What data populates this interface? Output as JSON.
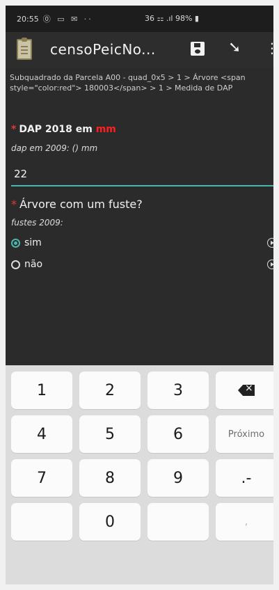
{
  "status_bar": {
    "time": "20:55",
    "left_icons": "⓪ ▭ ✉ ··",
    "system": "36 ⚏ .ıl 98% ▮"
  },
  "toolbar": {
    "title": "censoPeicNo...",
    "save_icon": "save-icon",
    "arrow_icon": "jump-arrow-icon",
    "more_icon": "more-vert-icon"
  },
  "breadcrumb": "Subquadrado da Parcela A00 - quad_0x5 > 1 > Árvore <span style=\"color:red\"> 180003</span> > 1 > Medida de DAP",
  "question1": {
    "required": "*",
    "label_before": "DAP 2018 em",
    "label_unit": "mm",
    "hint": "dap em 2009: () mm",
    "value": "22"
  },
  "question2": {
    "required": "*",
    "label": "Árvore com um fuste?",
    "hint": "fustes 2009:",
    "options": [
      {
        "label": "sim",
        "selected": true
      },
      {
        "label": "não",
        "selected": false
      }
    ]
  },
  "keyboard": {
    "rows": [
      [
        "1",
        "2",
        "3",
        "⌫"
      ],
      [
        "4",
        "5",
        "6",
        "Próximo"
      ],
      [
        "7",
        "8",
        "9",
        ".-"
      ],
      [
        "",
        "0",
        "",
        ","
      ]
    ]
  },
  "colors": {
    "accent": "#4db6ac",
    "required": "#e53935",
    "unit": "#ff1f1f",
    "background": "#2b2b2b"
  }
}
